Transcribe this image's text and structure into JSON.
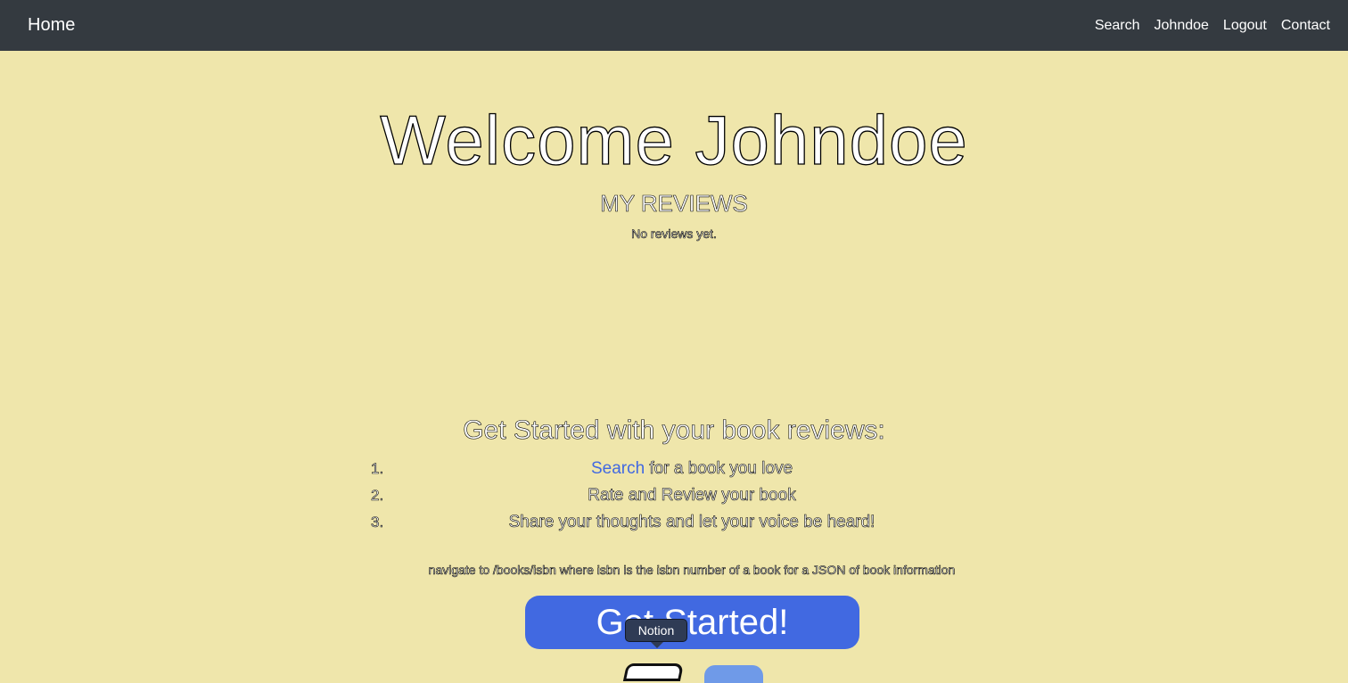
{
  "navbar": {
    "brand": "Home",
    "links": [
      "Search",
      "Johndoe",
      "Logout",
      "Contact"
    ]
  },
  "main": {
    "welcome_title": "Welcome Johndoe",
    "reviews_heading": "MY REVIEWS",
    "no_reviews_text": "No reviews yet."
  },
  "get_started": {
    "heading": "Get Started with your book reviews:",
    "steps": [
      {
        "number": "1.",
        "link_text": "Search",
        "text": " for a book you love"
      },
      {
        "number": "2.",
        "text": "Rate and Review your book"
      },
      {
        "number": "3.",
        "text": "Share your thoughts and let your voice be heard!"
      }
    ],
    "hint": "navigate to /books/isbn where isbn is the isbn number of a book for a JSON of book information",
    "button_label": "Get Started!"
  },
  "dock": {
    "tooltip": "Notion",
    "icons": [
      "notion-icon",
      "app-icon"
    ]
  },
  "colors": {
    "background": "#EFE6AB",
    "navbar": "#343A40",
    "accent": "#4169E1",
    "tooltip": "#2F3B55"
  }
}
